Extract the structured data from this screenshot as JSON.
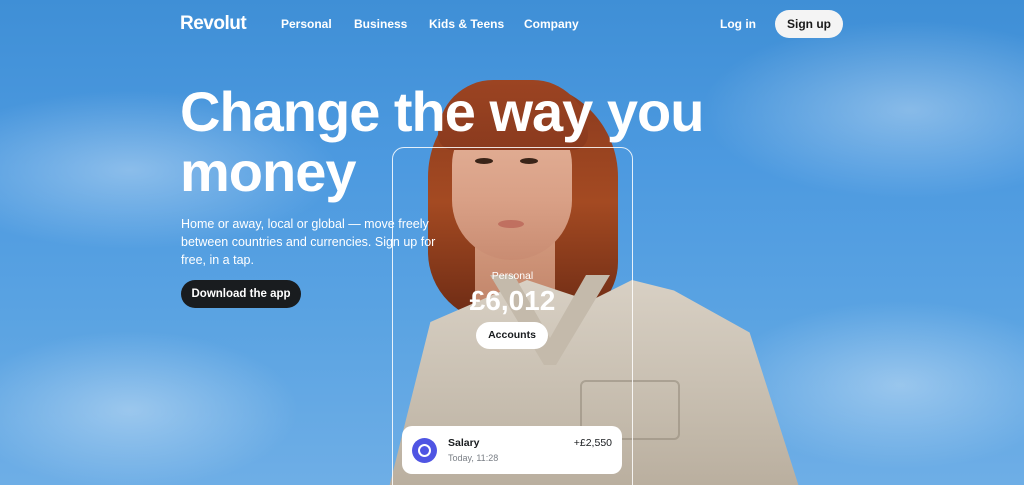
{
  "colors": {
    "sky": "#4d9ae0",
    "signup_bg": "#f4f4f4",
    "download_bg": "#191c1f",
    "tx_icon": "#4f55e3"
  },
  "nav": {
    "logo": "Revolut",
    "links": [
      "Personal",
      "Business",
      "Kids & Teens",
      "Company"
    ],
    "login": "Log in",
    "signup": "Sign up"
  },
  "hero": {
    "title": "Change the way you money",
    "subtitle": "Home or away, local or global — move freely between countries and currencies. Sign up for free, in a tap.",
    "cta": "Download the app"
  },
  "account": {
    "label": "Personal",
    "balance": "£6,012",
    "button": "Accounts"
  },
  "transaction": {
    "icon": "coins-icon",
    "title": "Salary",
    "time": "Today, 11:28",
    "amount": "+£2,550"
  }
}
